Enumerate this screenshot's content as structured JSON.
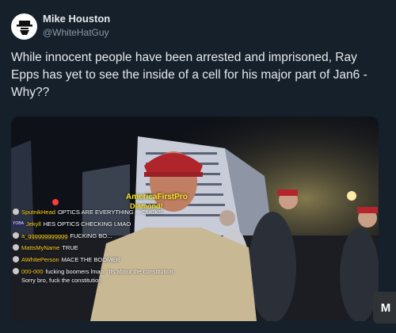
{
  "tweet": {
    "author_name": "Mike Houston",
    "author_handle": "@WhiteHatGuy",
    "text": "While innocent people have been arrested and imprisoned, Ray Epps has yet to see the inside of a cell for his major part of Jan6 - Why??",
    "avatar_icon": "spy-hat-icon"
  },
  "media": {
    "overlay_name": "AmericaFirstPro",
    "overlay_sub": "Diamond!",
    "chat": [
      {
        "icon": "circle",
        "user": "SputnikHead",
        "message": "OPTICS ARE EVERYTHING ... CUCKS"
      },
      {
        "icon": "badge",
        "badge_text": "YOBA",
        "user": "Jekyll",
        "message": "HES OPTICS CHECKING LMAO"
      },
      {
        "icon": "circle",
        "user": "a_gggggggggggg",
        "message": "FUCKING BO..."
      },
      {
        "icon": "circle",
        "user": "MattsMyName",
        "message": "TRUE"
      },
      {
        "icon": "circle",
        "user": "AWhitePerson",
        "message": "MACE THE BOOMER"
      },
      {
        "icon": "circle",
        "user": "000-000",
        "message": "fucking boomers lmao. \"its about the constitution. Sorry bro, fuck the constitution"
      }
    ]
  },
  "more_button_label": "M",
  "colors": {
    "background": "#15202b",
    "overlay_yellow": "#ffe81a"
  }
}
